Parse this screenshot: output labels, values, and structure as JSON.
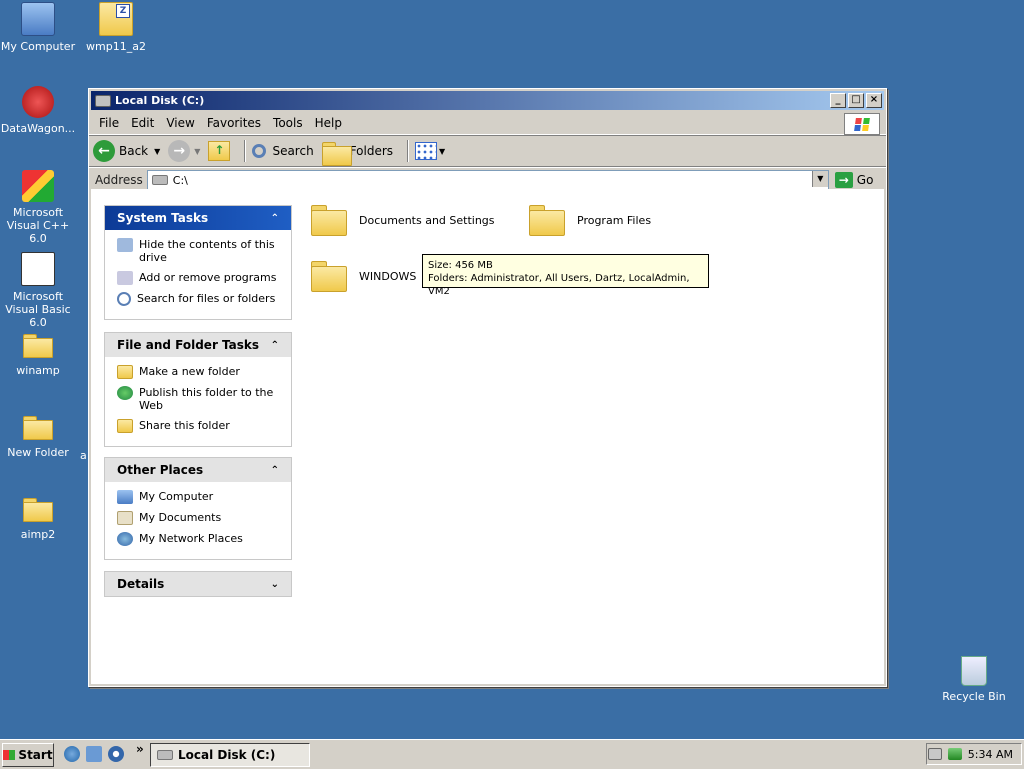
{
  "desktop": {
    "icons": [
      {
        "label": "My Computer"
      },
      {
        "label": "wmp11_a2"
      },
      {
        "label": "DataWagon..."
      },
      {
        "label": "Microsoft Visual C++ 6.0"
      },
      {
        "label": "Microsoft Visual Basic 6.0"
      },
      {
        "label": "winamp"
      },
      {
        "label": "New Folder"
      },
      {
        "label": "aimp2"
      },
      {
        "label": "Recycle Bin"
      }
    ],
    "stray_label": "a"
  },
  "window": {
    "title": "Local Disk (C:)",
    "menu": [
      "File",
      "Edit",
      "View",
      "Favorites",
      "Tools",
      "Help"
    ],
    "toolbar": {
      "back": "Back",
      "search": "Search",
      "folders": "Folders"
    },
    "address": {
      "label": "Address",
      "value": "C:\\",
      "go": "Go"
    },
    "panels": {
      "system_tasks": {
        "title": "System Tasks",
        "items": [
          "Hide the contents of this drive",
          "Add or remove programs",
          "Search for files or folders"
        ]
      },
      "file_folder_tasks": {
        "title": "File and Folder Tasks",
        "items": [
          "Make a new folder",
          "Publish this folder to the Web",
          "Share this folder"
        ]
      },
      "other_places": {
        "title": "Other Places",
        "items": [
          "My Computer",
          "My Documents",
          "My Network Places"
        ]
      },
      "details": {
        "title": "Details"
      }
    },
    "folders": [
      "Documents and Settings",
      "Program Files",
      "WINDOWS"
    ],
    "tooltip": {
      "line1": "Size: 456 MB",
      "line2": "Folders: Administrator, All Users, Dartz, LocalAdmin, VM2"
    }
  },
  "taskbar": {
    "start": "Start",
    "chevron": "»",
    "task": "Local Disk (C:)",
    "clock": "5:34 AM"
  }
}
